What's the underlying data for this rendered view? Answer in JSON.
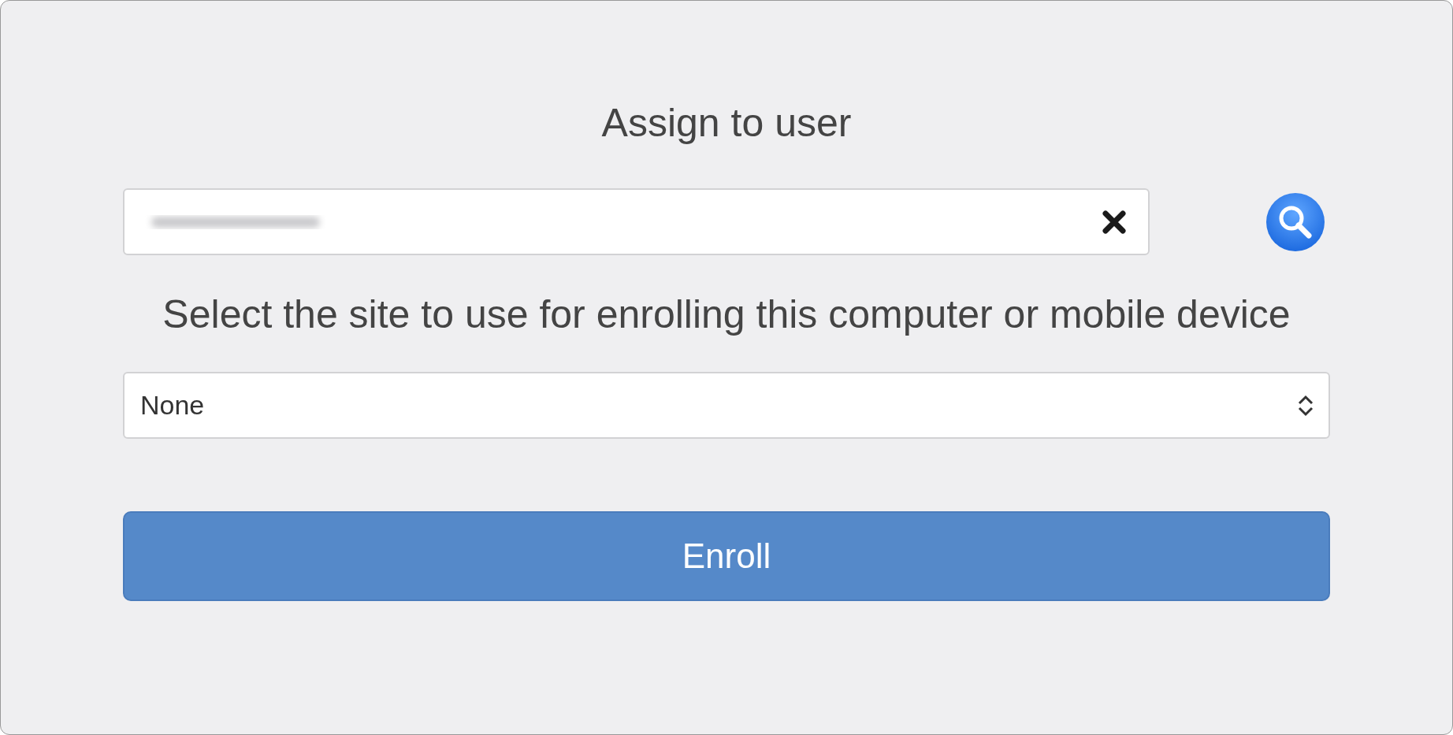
{
  "title": "Assign to user",
  "prompt": "Select the site to use for enrolling this computer or mobile device",
  "site_select": {
    "value": "None"
  },
  "enroll_button": {
    "label": "Enroll"
  }
}
